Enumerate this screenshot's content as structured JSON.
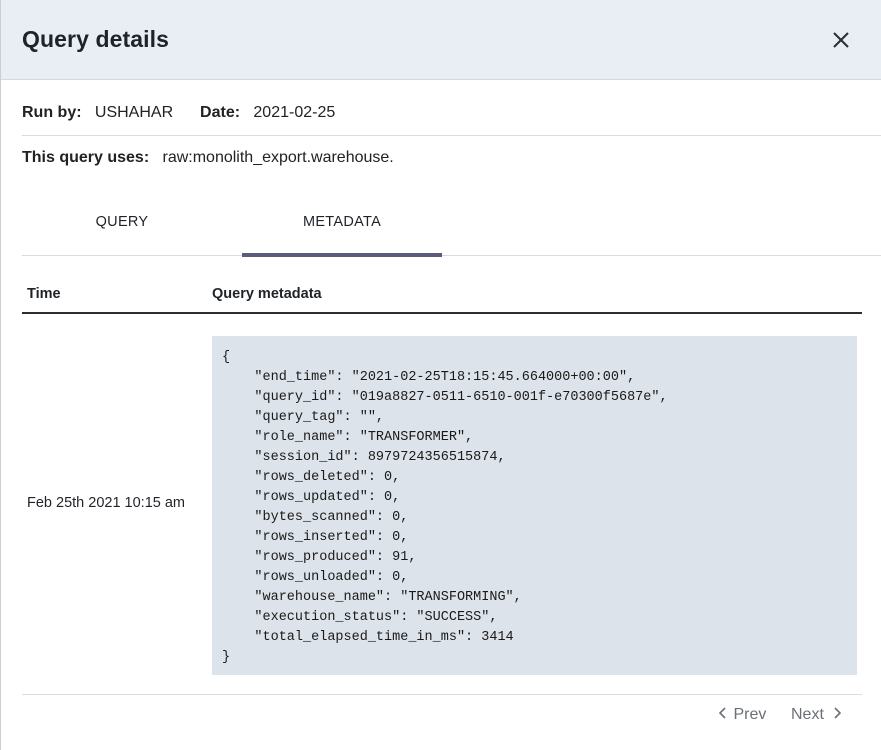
{
  "modal": {
    "title": "Query details",
    "close_icon": "close-icon"
  },
  "info": {
    "run_by_label": "Run by:",
    "run_by_value": "USHAHAR",
    "date_label": "Date:",
    "date_value": "2021-02-25",
    "uses_label": "This query uses:",
    "uses_value": "raw:monolith_export.warehouse."
  },
  "tabs": [
    {
      "label": "QUERY",
      "active": false
    },
    {
      "label": "METADATA",
      "active": true
    }
  ],
  "table": {
    "headers": [
      "Time",
      "Query metadata"
    ],
    "rows": [
      {
        "time": "Feb 25th 2021 10:15 am",
        "metadata_lines": [
          "{",
          "    \"end_time\": \"2021-02-25T18:15:45.664000+00:00\",",
          "    \"query_id\": \"019a8827-0511-6510-001f-e70300f5687e\",",
          "    \"query_tag\": \"\",",
          "    \"role_name\": \"TRANSFORMER\",",
          "    \"session_id\": 8979724356515874,",
          "    \"rows_deleted\": 0,",
          "    \"rows_updated\": 0,",
          "    \"bytes_scanned\": 0,",
          "    \"rows_inserted\": 0,",
          "    \"rows_produced\": 91,",
          "    \"rows_unloaded\": 0,",
          "    \"warehouse_name\": \"TRANSFORMING\",",
          "    \"execution_status\": \"SUCCESS\",",
          "    \"total_elapsed_time_in_ms\": 3414",
          "}"
        ]
      }
    ]
  },
  "pagination": {
    "prev_label": "Prev",
    "next_label": "Next",
    "prev_icon": "chevron-left-icon",
    "next_icon": "chevron-right-icon"
  },
  "colors": {
    "header_bg": "#e9eef5",
    "code_bg": "#dde3ea",
    "tab_indicator": "#5b5b7e",
    "pager_text": "#6b6f78"
  }
}
